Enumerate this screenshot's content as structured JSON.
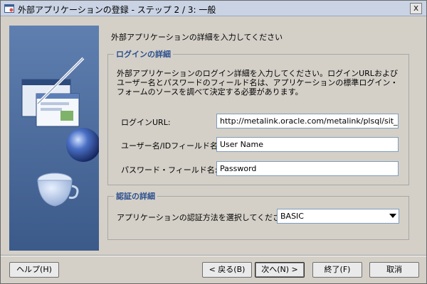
{
  "window": {
    "title": "外部アプリケーションの登録 - ステップ 2 / 3: 一般",
    "close_label": "x"
  },
  "intro_text": "外部アプリケーションの詳細を入力してください",
  "login_group": {
    "title": "ログインの詳細",
    "description": "外部アプリケーションのログイン詳細を入力してください。ログインURLおよびユーザー名とパスワードのフィールド名は、アプリケーションの標準ログイン・フォームのソースを調べて決定する必要があります。",
    "login_url_label": "ログインURL:",
    "login_url_value": "http://metalink.oracle.com/metalink/plsql/sit_ma",
    "username_label": "ユーザー名/IDフィールド名:",
    "username_value": "User Name",
    "password_label": "パスワード・フィールド名:",
    "password_value": "Password"
  },
  "auth_group": {
    "title": "認証の詳細",
    "method_label": "アプリケーションの認証方法を選択してください:",
    "method_value": "BASIC"
  },
  "buttons": {
    "help": "ヘルプ(H)",
    "back": "< 戻る(B)",
    "next": "次へ(N) >",
    "finish": "終了(F)",
    "cancel": "取消"
  },
  "colors": {
    "group_title": "#2b4f8d",
    "panel_bg": "#4d6a9a",
    "dialog_bg": "#d4d0c8"
  },
  "icons": [
    "app-window-icon",
    "close-icon",
    "wizard-illustration",
    "dropdown-arrow-icon"
  ]
}
